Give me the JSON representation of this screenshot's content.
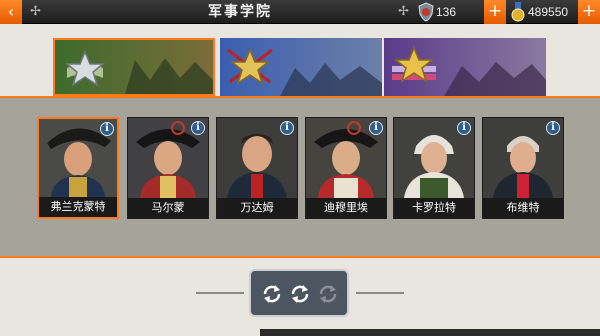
{
  "header": {
    "title": "军事学院",
    "back_icon": "back-arrow-icon",
    "resources": [
      {
        "name": "medal",
        "icon": "shield-medal-icon",
        "value": "136"
      },
      {
        "name": "gold",
        "icon": "gold-medal-icon",
        "value": "489550"
      }
    ],
    "plus_label": "+"
  },
  "tabs": [
    {
      "name": "tab-green-rank",
      "icon": "single-star-icon",
      "selected": true
    },
    {
      "name": "tab-blue-rank",
      "icon": "star-with-swords-icon",
      "selected": false
    },
    {
      "name": "tab-purple-rank",
      "icon": "star-with-ribbons-icon",
      "selected": false
    }
  ],
  "generals": [
    {
      "name": "弗兰克蒙特",
      "selected": true
    },
    {
      "name": "马尔蒙",
      "selected": false
    },
    {
      "name": "万达姆",
      "selected": false
    },
    {
      "name": "迪穆里埃",
      "selected": false
    },
    {
      "name": "卡罗拉特",
      "selected": false
    },
    {
      "name": "布维特",
      "selected": false
    }
  ],
  "info_label": "i",
  "controls": [
    {
      "name": "refresh-left-button",
      "icon": "refresh-icon"
    },
    {
      "name": "refresh-center-button",
      "icon": "refresh-icon"
    },
    {
      "name": "refresh-disabled-button",
      "icon": "refresh-icon"
    }
  ],
  "colors": {
    "accent": "#ff7a1a",
    "topbar": "#2a2a2a",
    "panel": "#a6a39b",
    "background": "#e9e6df"
  }
}
